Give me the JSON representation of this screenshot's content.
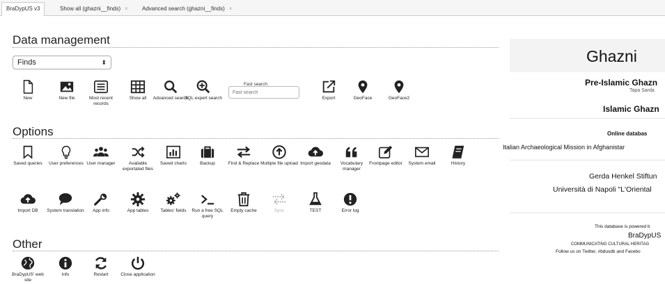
{
  "tabs": [
    {
      "label": "BraDypUS v3",
      "active": true
    },
    {
      "label": "Show all (ghazni__finds)",
      "close": "×"
    },
    {
      "label": "Advanced search (ghazni__finds)",
      "close": "×"
    }
  ],
  "sections": {
    "data": "Data management",
    "options": "Options",
    "other": "Other"
  },
  "table_select": {
    "value": "Finds",
    "arrow": "⬍"
  },
  "fast_search": {
    "label": "Fast search",
    "placeholder": "Fast search"
  },
  "data_tools": [
    {
      "icon": "file-icon",
      "label": "New"
    },
    {
      "icon": "image-icon",
      "label": "New file"
    },
    {
      "icon": "list-icon",
      "label": "Most recent records"
    },
    {
      "icon": "table-icon",
      "label": "Show all"
    },
    {
      "icon": "search-icon",
      "label": "Advanced search"
    },
    {
      "icon": "zoom-plus-icon",
      "label": "SQL expert search"
    },
    {
      "icon": "export-icon",
      "label": "Export"
    },
    {
      "icon": "map-marker-icon",
      "label": "GeoFace"
    },
    {
      "icon": "map-marker-icon",
      "label": "GeoFace2"
    }
  ],
  "option_tools_row1": [
    {
      "icon": "bookmark-icon",
      "label": "Saved queries"
    },
    {
      "icon": "bulb-icon",
      "label": "User preferences"
    },
    {
      "icon": "users-icon",
      "label": "User manager"
    },
    {
      "icon": "shuffle-icon",
      "label": "Available exportated files"
    },
    {
      "icon": "bar-chart-icon",
      "label": "Saved charts"
    },
    {
      "icon": "briefcase-icon",
      "label": "Backup"
    },
    {
      "icon": "exchange-icon",
      "label": "Find & Replace"
    },
    {
      "icon": "upload-circle-icon",
      "label": "Multiple file upload"
    },
    {
      "icon": "cloud-upload-icon",
      "label": "Import geodata"
    },
    {
      "icon": "quote-icon",
      "label": "Vocabulary manager"
    },
    {
      "icon": "edit-icon",
      "label": "Frontpage editor"
    },
    {
      "icon": "envelope-icon",
      "label": "System email"
    },
    {
      "icon": "book-icon",
      "label": "History"
    }
  ],
  "option_tools_row2": [
    {
      "icon": "cloud-upload-icon",
      "label": "Import DB"
    },
    {
      "icon": "speech-bubble-icon",
      "label": "System translation"
    },
    {
      "icon": "wrench-icon",
      "label": "App info"
    },
    {
      "icon": "cog-icon",
      "label": "App tables"
    },
    {
      "icon": "cogs-icon",
      "label": "Tables' fields"
    },
    {
      "icon": "terminal-icon",
      "label": "Run a free SQL query"
    },
    {
      "icon": "trash-icon",
      "label": "Empty cache"
    },
    {
      "icon": "sync-icon",
      "label": "Sync",
      "disabled": true
    },
    {
      "icon": "flask-icon",
      "label": "TEST"
    },
    {
      "icon": "exclamation-icon",
      "label": "Error log"
    }
  ],
  "other_tools": [
    {
      "icon": "globe-icon",
      "label": "BraDypUS' web site"
    },
    {
      "icon": "info-icon",
      "label": "Info"
    },
    {
      "icon": "refresh-icon",
      "label": "Restart"
    },
    {
      "icon": "power-icon",
      "label": "Close application"
    }
  ],
  "right": {
    "title": "Ghazni",
    "subtitle1": "Pre-Islamic Ghazn",
    "subtitle1_small": "Tapa Sarda",
    "subtitle2": "Islamic Ghazn",
    "online": "Online databas",
    "mission": "Italian Archaeological Mission in Afghanistar",
    "sponsor1": "Gerda Henkel Stiftun",
    "sponsor2": "Università di Napoli \"L'Oriental",
    "powered": "This database is powered b",
    "brand": "BraDypUS",
    "tagline": "COMMUNICATING CULTURAL HERITAG",
    "follow": "Follow us on Twitter, #bdusdb and Facebo"
  }
}
